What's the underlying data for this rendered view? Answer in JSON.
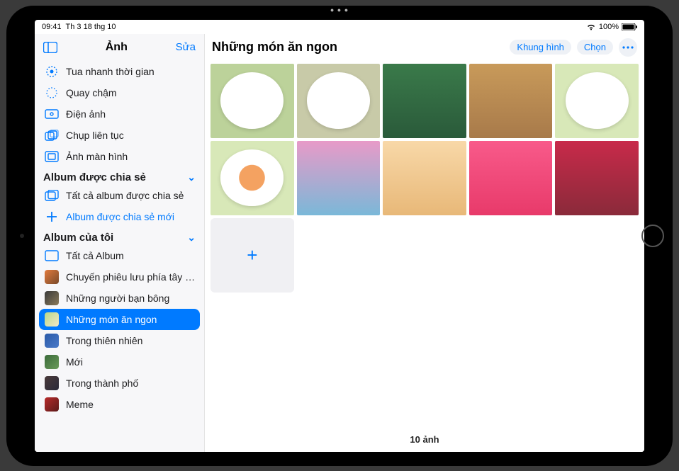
{
  "status": {
    "time": "09:41",
    "date": "Th 3 18 thg 10",
    "battery": "100%"
  },
  "sidebar": {
    "title": "Ảnh",
    "edit": "Sửa",
    "mediaTypes": [
      {
        "label": "Tua nhanh thời gian"
      },
      {
        "label": "Quay chậm"
      },
      {
        "label": "Điện ảnh"
      },
      {
        "label": "Chụp liên tục"
      },
      {
        "label": "Ảnh màn hình"
      }
    ],
    "sharedTitle": "Album được chia sẻ",
    "sharedItems": [
      {
        "label": "Tất cả album được chia sẻ"
      },
      {
        "label": "Album được chia sẻ mới"
      }
    ],
    "myTitle": "Album của tôi",
    "myItems": [
      {
        "label": "Tất cả Album"
      },
      {
        "label": "Chuyến phiêu lưu phía tây nam"
      },
      {
        "label": "Những người bạn bông"
      },
      {
        "label": "Những món ăn ngon"
      },
      {
        "label": "Trong thiên nhiên"
      },
      {
        "label": "Mới"
      },
      {
        "label": "Trong thành phố"
      },
      {
        "label": "Meme"
      }
    ]
  },
  "main": {
    "title": "Những món ăn ngon",
    "slideshow": "Khung hình",
    "select": "Chọn",
    "count": "10 ảnh"
  }
}
